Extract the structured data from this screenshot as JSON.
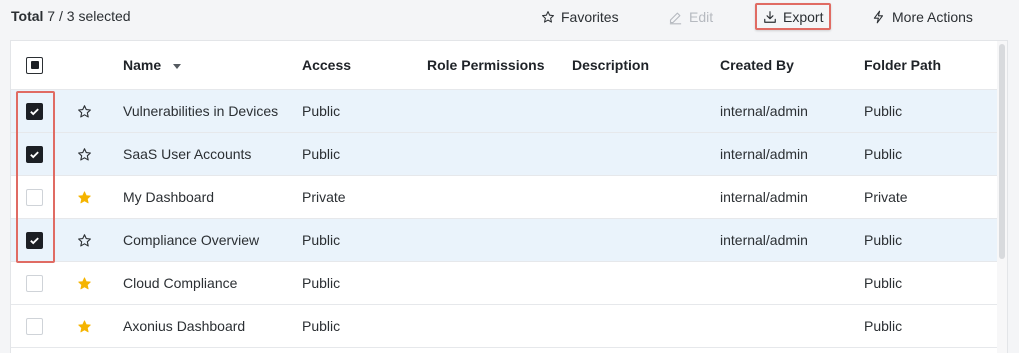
{
  "toolbar": {
    "total_label": "Total",
    "total_count": "7",
    "selected_text": "/ 3 selected",
    "favorites_label": "Favorites",
    "edit_label": "Edit",
    "export_label": "Export",
    "more_actions_label": "More Actions"
  },
  "columns": {
    "name": "Name",
    "access": "Access",
    "role_permissions": "Role Permissions",
    "description": "Description",
    "created_by": "Created By",
    "folder_path": "Folder Path"
  },
  "rows": [
    {
      "name": "Vulnerabilities in Devices",
      "access": "Public",
      "role_permissions": "",
      "description": "",
      "created_by": "internal/admin",
      "folder_path": "Public",
      "checked": true,
      "favorite": false
    },
    {
      "name": "SaaS User Accounts",
      "access": "Public",
      "role_permissions": "",
      "description": "",
      "created_by": "internal/admin",
      "folder_path": "Public",
      "checked": true,
      "favorite": false
    },
    {
      "name": "My Dashboard",
      "access": "Private",
      "role_permissions": "",
      "description": "",
      "created_by": "internal/admin",
      "folder_path": "Private",
      "checked": false,
      "favorite": true
    },
    {
      "name": "Compliance Overview",
      "access": "Public",
      "role_permissions": "",
      "description": "",
      "created_by": "internal/admin",
      "folder_path": "Public",
      "checked": true,
      "favorite": false
    },
    {
      "name": "Cloud Compliance",
      "access": "Public",
      "role_permissions": "",
      "description": "",
      "created_by": "",
      "folder_path": "Public",
      "checked": false,
      "favorite": true
    },
    {
      "name": "Axonius Dashboard",
      "access": "Public",
      "role_permissions": "",
      "description": "",
      "created_by": "",
      "folder_path": "Public",
      "checked": false,
      "favorite": true
    }
  ],
  "colors": {
    "selected_row": "#eaf3fb",
    "highlight": "#e06b63",
    "star_filled": "#f5b400",
    "checkbox_checked": "#1c1f24"
  },
  "icons": {
    "favorites": "star-outline-icon",
    "edit": "pencil-icon",
    "export": "download-icon",
    "more_actions": "lightning-icon",
    "sort": "sort-desc-icon"
  }
}
